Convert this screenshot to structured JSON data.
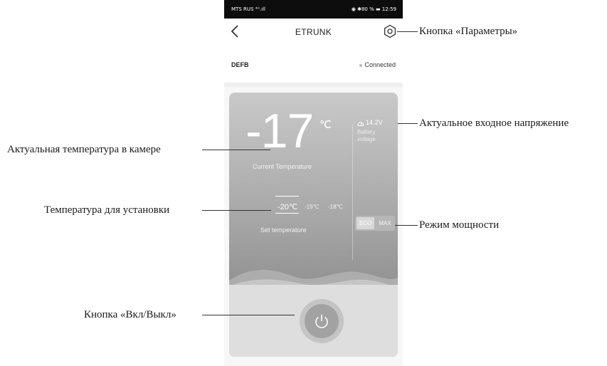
{
  "status_bar": {
    "carrier": "MTS RUS ⁴ᴳ.ıll",
    "right": "◉ ✱80 % ▬ 12:59"
  },
  "app_bar": {
    "title": "ETRUNK"
  },
  "device": {
    "name": "DEFB",
    "status": "Connected"
  },
  "control": {
    "current_temperature": "-17",
    "temperature_unit": "℃",
    "current_temperature_label": "Current Temperature",
    "voltage": "14.2V",
    "voltage_label": "Battery voltage",
    "set_temperature_current": "-20℃",
    "set_temperature_options": [
      "-19℃",
      "-18℃"
    ],
    "set_temperature_label": "Set temperature",
    "modes": [
      "ECO",
      "MAX"
    ],
    "active_mode": "ECO"
  },
  "annotations": {
    "settings_button": "Кнопка «Параметры»",
    "input_voltage": "Актуальное входное напряжение",
    "chamber_temperature": "Актуальная температура в камере",
    "set_temperature": "Температура для установки",
    "power_mode": "Режим мощности",
    "power_button": "Кнопка «Вкл/Выкл»"
  },
  "colors": {
    "card_top": "#c9c9c9",
    "card_bottom": "#8a8a8a",
    "bottom_pane": "#dedede"
  }
}
